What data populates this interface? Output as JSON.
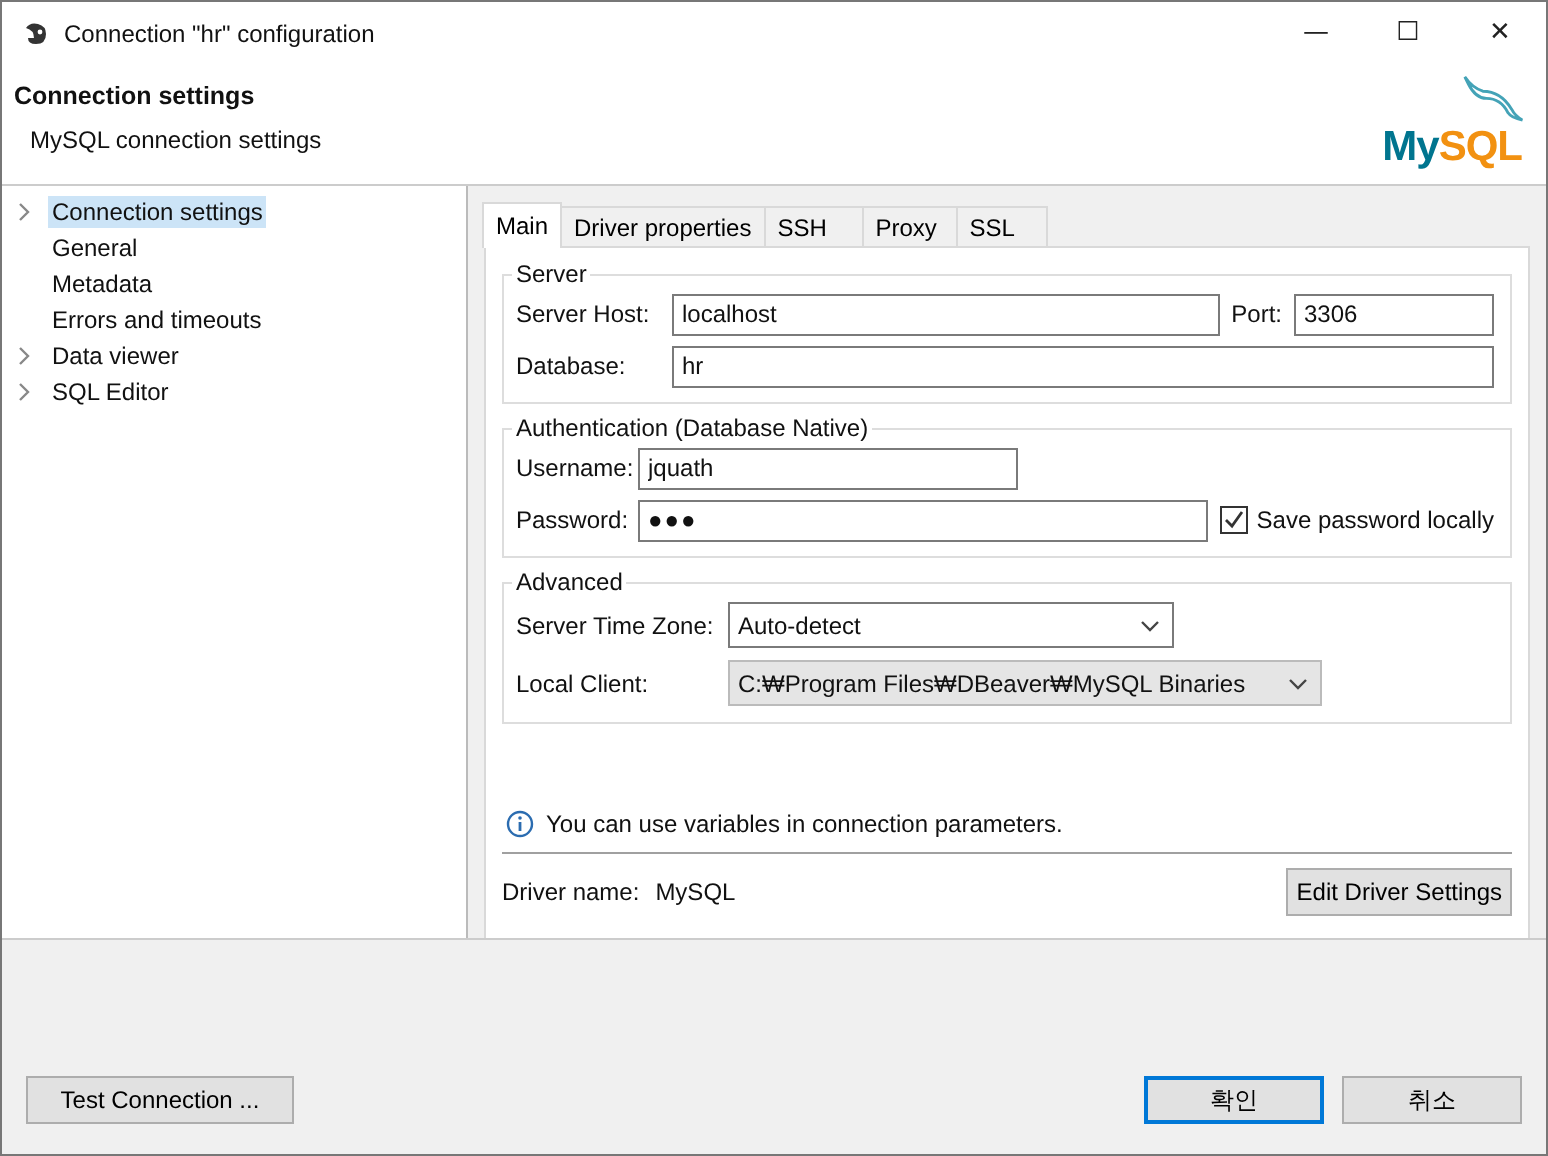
{
  "window": {
    "title": "Connection \"hr\" configuration",
    "controls": [
      "—",
      "☐",
      "✕"
    ]
  },
  "header": {
    "title": "Connection settings",
    "subtitle": "MySQL connection settings",
    "logo": [
      "My",
      "SQL"
    ]
  },
  "tree": [
    {
      "label": "Connection settings",
      "kind": "folder",
      "selected": true
    },
    {
      "label": "General",
      "kind": "leaf",
      "selected": false
    },
    {
      "label": "Metadata",
      "kind": "leaf",
      "selected": false
    },
    {
      "label": "Errors and timeouts",
      "kind": "leaf",
      "selected": false
    },
    {
      "label": "Data viewer",
      "kind": "folder",
      "selected": false
    },
    {
      "label": "SQL Editor",
      "kind": "folder",
      "selected": false
    }
  ],
  "tabs": [
    {
      "label": "Main",
      "selected": true
    },
    {
      "label": "Driver properties",
      "selected": false
    },
    {
      "label": "SSH",
      "selected": false
    },
    {
      "label": "Proxy",
      "selected": false
    },
    {
      "label": "SSL",
      "selected": false
    }
  ],
  "server": {
    "title": "Server",
    "host_label": "Server Host:",
    "host": "localhost",
    "port_label": "Port:",
    "port": "3306",
    "db_label": "Database:",
    "db": "hr"
  },
  "auth": {
    "title": "Authentication (Database Native)",
    "user_label": "Username:",
    "user": "jquath",
    "pass_label": "Password:",
    "pass": "●●●",
    "save_label": "Save password locally",
    "save_checked": true
  },
  "advanced": {
    "title": "Advanced",
    "tz_label": "Server Time Zone:",
    "tz": "Auto-detect",
    "tz_disabled": false,
    "client_label": "Local Client:",
    "client": "C:₩Program Files₩DBeaver₩MySQL Binaries",
    "client_disabled": true
  },
  "info": "You can use variables in connection parameters.",
  "driver": {
    "label": "Driver name:",
    "value": "MySQL",
    "button": "Edit Driver Settings"
  },
  "footer": {
    "test": "Test Connection ...",
    "buttons": [
      {
        "label": "확인",
        "default": true
      },
      {
        "label": "취소",
        "default": false
      }
    ]
  }
}
